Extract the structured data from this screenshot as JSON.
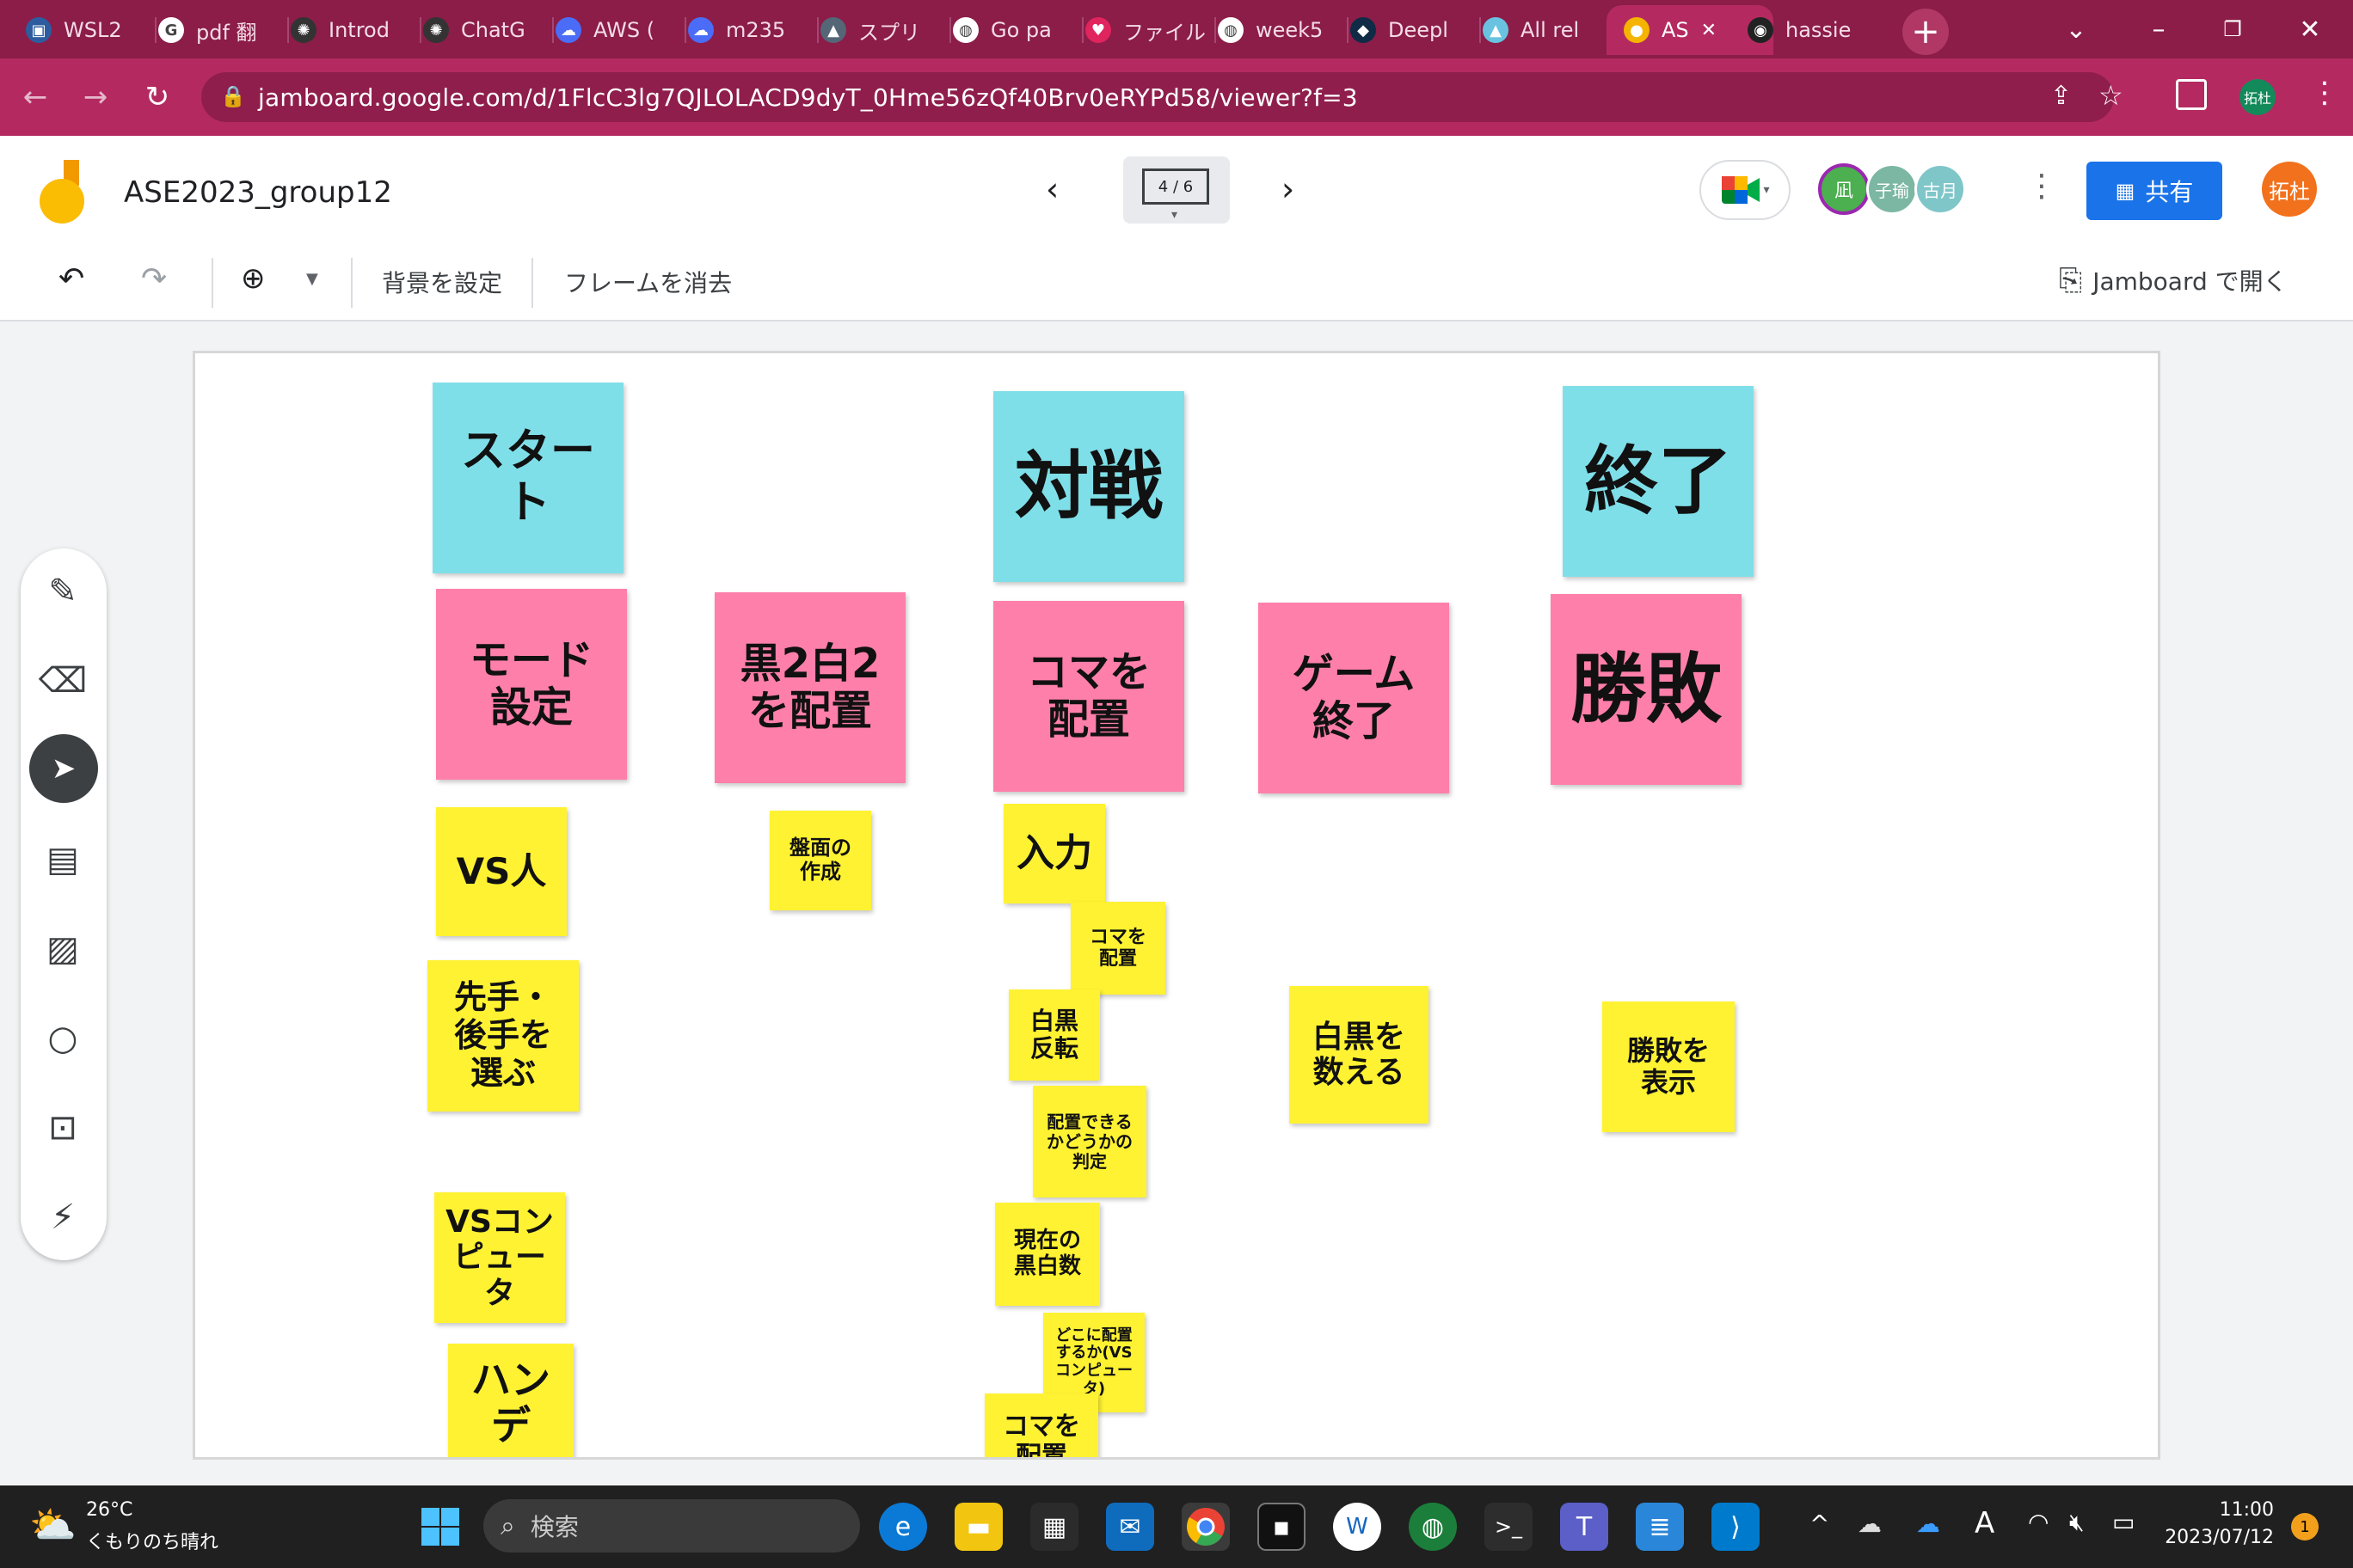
{
  "browser": {
    "tabs": [
      {
        "label": "WSL2",
        "icon": "wsl-icon",
        "color": "#2d5d9f"
      },
      {
        "label": "pdf 翻",
        "icon": "google-icon",
        "color": "#ffffff"
      },
      {
        "label": "Introd",
        "icon": "openai-icon",
        "color": "#333333"
      },
      {
        "label": "ChatG",
        "icon": "openai-icon",
        "color": "#333333"
      },
      {
        "label": "AWS (",
        "icon": "cloud-icon",
        "color": "#4a6cf7"
      },
      {
        "label": "m235",
        "icon": "cloud-icon",
        "color": "#4a6cf7"
      },
      {
        "label": "スプリ",
        "icon": "app-icon",
        "color": "#556677"
      },
      {
        "label": "Go pa",
        "icon": "globe-icon",
        "color": "#ffffff"
      },
      {
        "label": "ファイル",
        "icon": "heart-icon",
        "color": "#e0245e"
      },
      {
        "label": "week5",
        "icon": "globe-icon",
        "color": "#ffffff"
      },
      {
        "label": "Deepl",
        "icon": "deepl-icon",
        "color": "#0f2b46"
      },
      {
        "label": "All rel",
        "icon": "app-icon",
        "color": "#69c3e0"
      },
      {
        "label": "AS",
        "icon": "jamboard-icon",
        "color": "#f4b400",
        "active": true
      },
      {
        "label": "hassie",
        "icon": "github-icon",
        "color": "#222222"
      }
    ],
    "url": "jamboard.google.com/d/1FlcC3lg7QJLOLACD9dyT_0Hme56zQf40Brv0eRYPd58/viewer?f=3",
    "profile_initials": "拓杜"
  },
  "app": {
    "title": "ASE2023_group12",
    "frame_indicator": "4 / 6",
    "collaborators": [
      "凪",
      "子瑜",
      "古月"
    ],
    "share_label": "共有",
    "user_initials": "拓杜"
  },
  "toolbar": {
    "set_background": "背景を設定",
    "clear_frame": "フレームを消去",
    "open_in_jamboard": "Jamboard で開く"
  },
  "notes": [
    {
      "id": "start",
      "text": "スター\nト",
      "color": "blue"
    },
    {
      "id": "battle",
      "text": "対戦",
      "color": "blue"
    },
    {
      "id": "end",
      "text": "終了",
      "color": "blue"
    },
    {
      "id": "mode",
      "text": "モード\n設定",
      "color": "pink"
    },
    {
      "id": "place22",
      "text": "黒2白2\nを配置",
      "color": "pink"
    },
    {
      "id": "place_piece",
      "text": "コマを\n配置",
      "color": "pink"
    },
    {
      "id": "game_end",
      "text": "ゲーム\n終了",
      "color": "pink"
    },
    {
      "id": "result",
      "text": "勝敗",
      "color": "pink"
    },
    {
      "id": "vs_human",
      "text": "VS人",
      "color": "yellow"
    },
    {
      "id": "board",
      "text": "盤面の\n作成",
      "color": "yellow"
    },
    {
      "id": "input",
      "text": "入力",
      "color": "yellow"
    },
    {
      "id": "place_small",
      "text": "コマを\n配置",
      "color": "yellow"
    },
    {
      "id": "order",
      "text": "先手・\n後手を\n選ぶ",
      "color": "yellow"
    },
    {
      "id": "flip",
      "text": "白黒\n反転",
      "color": "yellow"
    },
    {
      "id": "count",
      "text": "白黒を\n数える",
      "color": "yellow"
    },
    {
      "id": "show_result",
      "text": "勝敗を\n表示",
      "color": "yellow"
    },
    {
      "id": "can_place",
      "text": "配置できる\nかどうかの\n判定",
      "color": "yellow"
    },
    {
      "id": "vs_cpu",
      "text": "VSコン\nピュー\nタ",
      "color": "yellow"
    },
    {
      "id": "current_count",
      "text": "現在の\n黒白数",
      "color": "yellow"
    },
    {
      "id": "where_cpu",
      "text": "どこに配置\nするか(VS\nコンピュー\nタ)",
      "color": "yellow"
    },
    {
      "id": "handicap",
      "text": "ハン\nデ",
      "color": "yellow"
    },
    {
      "id": "place_bottom",
      "text": "コマを\n配置",
      "color": "yellow"
    }
  ],
  "taskbar": {
    "weather_temp": "26°C",
    "weather_desc": "くもりのち晴れ",
    "search_placeholder": "検索",
    "time": "11:00",
    "date": "2023/07/12",
    "notification_count": "1",
    "ime_mode": "A"
  }
}
